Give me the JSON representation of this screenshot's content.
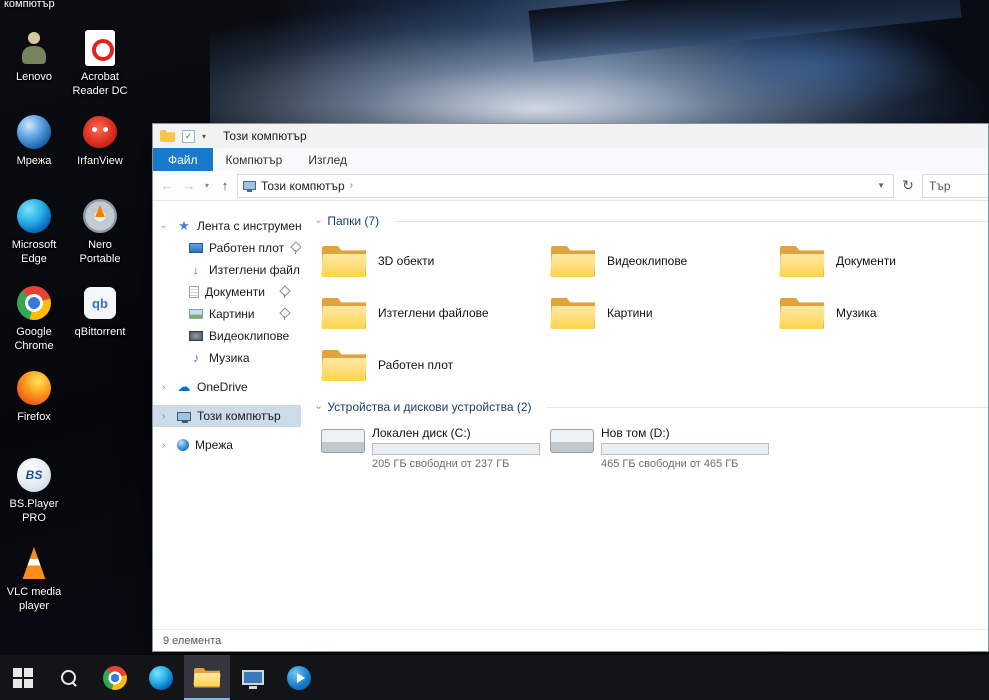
{
  "colors": {
    "accent_blue": "#1979ca",
    "selection": "#ccdbe8",
    "drive_bar_fill": "#26a0da",
    "folder_yellow": "#ffd34e",
    "taskbar_bg": "#121418"
  },
  "desktop": {
    "cut_label": "компютър",
    "icons": [
      {
        "label": "Lenovo"
      },
      {
        "label": "Acrobat Reader DC"
      },
      {
        "label": "Мрежа"
      },
      {
        "label": "IrfanView"
      },
      {
        "label": "Microsoft Edge"
      },
      {
        "label": "Nero Portable"
      },
      {
        "label": "Google Chrome"
      },
      {
        "label": "qBittorrent",
        "glyph_text": "qb"
      },
      {
        "label": "Firefox"
      },
      {
        "label": "BS.Player PRO",
        "glyph_text": "BS"
      },
      {
        "label": "VLC media player"
      }
    ]
  },
  "explorer": {
    "title": "Този компютър",
    "tabs": [
      {
        "label": "Файл"
      },
      {
        "label": "Компютър"
      },
      {
        "label": "Изглед"
      }
    ],
    "address": {
      "breadcrumb": "Този компютър",
      "search_text": "Тър"
    },
    "sidebar": {
      "items": [
        {
          "label": "Лента с инструменти"
        },
        {
          "label": "Работен плот",
          "pinned": true
        },
        {
          "label": "Изтеглени файл",
          "pinned": true
        },
        {
          "label": "Документи",
          "pinned": true
        },
        {
          "label": "Картини",
          "pinned": true
        },
        {
          "label": "Видеоклипове"
        },
        {
          "label": "Музика"
        },
        {
          "label": "OneDrive"
        },
        {
          "label": "Този компютър",
          "selected": true
        },
        {
          "label": "Мрежа"
        }
      ]
    },
    "sections": {
      "folders": {
        "title": "Папки (7)",
        "items": [
          "3D обекти",
          "Видеоклипове",
          "Документи",
          "Изтеглени файлове",
          "Картини",
          "Музика",
          "Работен плот"
        ]
      },
      "drives": {
        "title": "Устройства и дискови устройства (2)",
        "items": [
          {
            "name": "Локален диск (C:)",
            "free_text": "205 ГБ свободни от 237 ГБ",
            "used_percent": 14
          },
          {
            "name": "Нов том (D:)",
            "free_text": "465 ГБ свободни от 465 ГБ",
            "used_percent": 0
          }
        ]
      }
    },
    "status": "9 елемента"
  },
  "taskbar": {
    "icons": [
      "windows-start",
      "search",
      "chrome",
      "edge",
      "file-explorer",
      "system-monitor",
      "media-player"
    ]
  }
}
